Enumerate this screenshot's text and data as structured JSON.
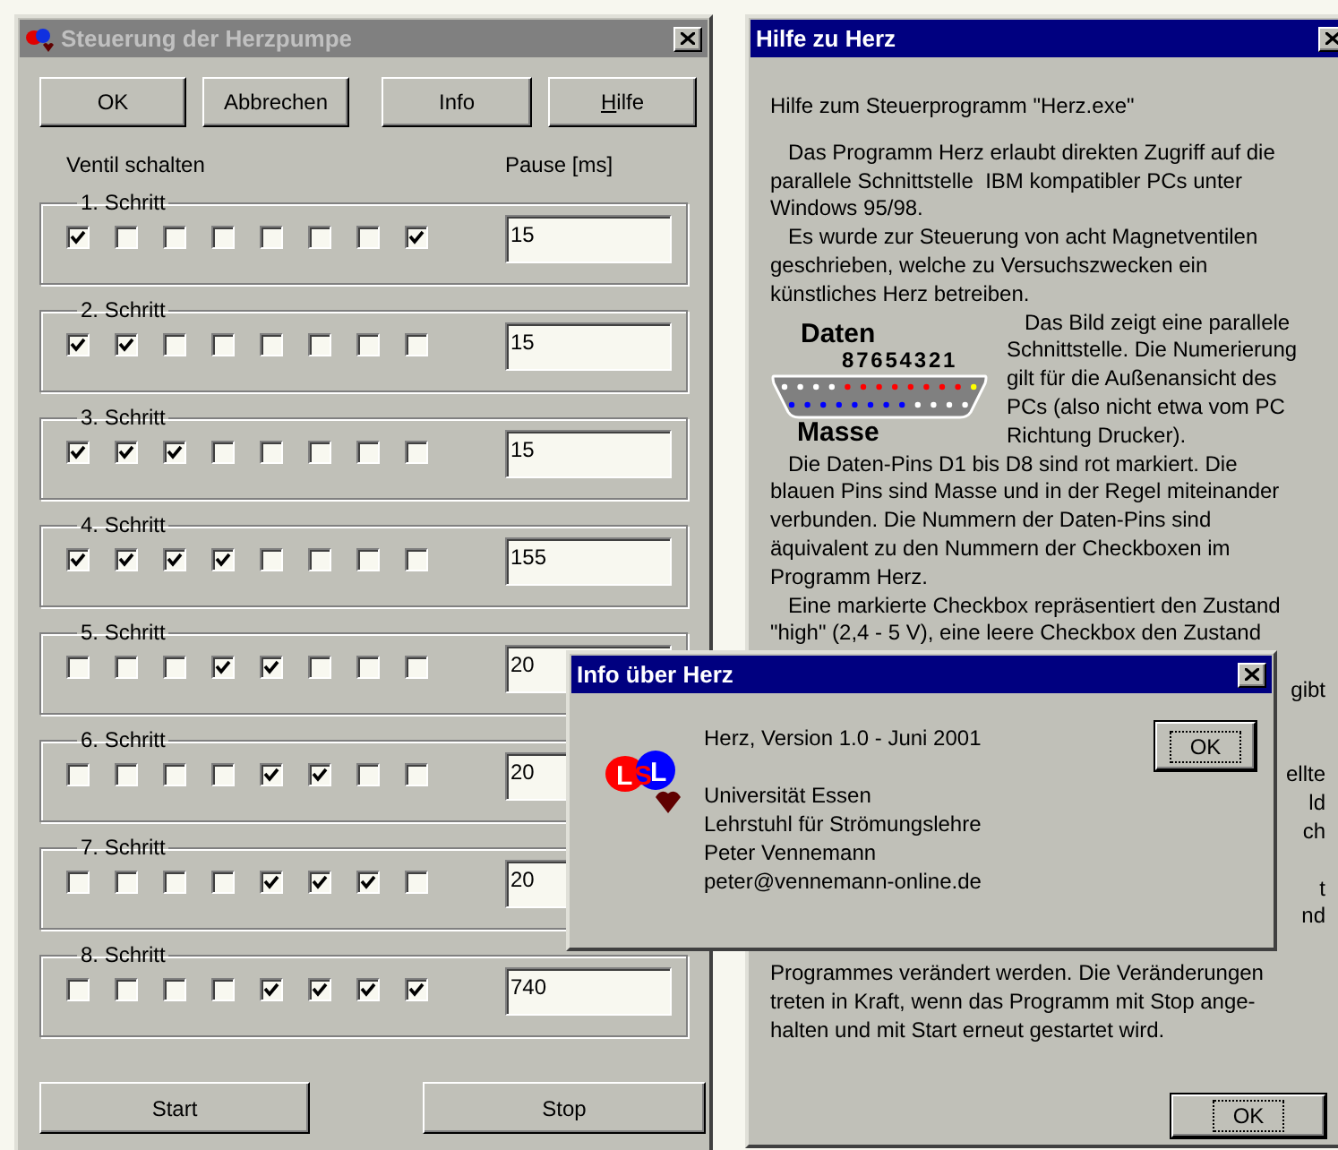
{
  "control_window": {
    "title": "Steuerung der Herzpumpe",
    "active": false,
    "buttons": [
      {
        "label": "OK"
      },
      {
        "label": "Abbrechen"
      },
      {
        "label": "Info"
      },
      {
        "mnemonic": "H",
        "label": "ilfe"
      }
    ],
    "valves_heading": "Ventil schalten",
    "pause_heading": "Pause [ms]",
    "steps": [
      {
        "label": "1. Schritt",
        "valves": [
          true,
          false,
          false,
          false,
          false,
          false,
          false,
          true
        ],
        "pause": "15"
      },
      {
        "label": "2. Schritt",
        "valves": [
          true,
          true,
          false,
          false,
          false,
          false,
          false,
          false
        ],
        "pause": "15"
      },
      {
        "label": "3. Schritt",
        "valves": [
          true,
          true,
          true,
          false,
          false,
          false,
          false,
          false
        ],
        "pause": "15"
      },
      {
        "label": "4. Schritt",
        "valves": [
          true,
          true,
          true,
          true,
          false,
          false,
          false,
          false
        ],
        "pause": "155"
      },
      {
        "label": "5. Schritt",
        "valves": [
          false,
          false,
          false,
          true,
          true,
          false,
          false,
          false
        ],
        "pause": "20"
      },
      {
        "label": "6. Schritt",
        "valves": [
          false,
          false,
          false,
          false,
          true,
          true,
          false,
          false
        ],
        "pause": "20"
      },
      {
        "label": "7. Schritt",
        "valves": [
          false,
          false,
          false,
          false,
          true,
          true,
          true,
          false
        ],
        "pause": "20"
      },
      {
        "label": "8. Schritt",
        "valves": [
          false,
          false,
          false,
          false,
          true,
          true,
          true,
          true
        ],
        "pause": "740"
      }
    ],
    "actions": [
      {
        "label": "Start"
      },
      {
        "label": "Stop"
      }
    ]
  },
  "help_window": {
    "title": "Hilfe zu Herz",
    "active": true,
    "heading": "Hilfe zum Steuerprogramm \"Herz.exe\"",
    "intro_lines": [
      {
        "text": "Das Programm Herz erlaubt direkten Zugriff auf die",
        "indent": true
      },
      {
        "text": "parallele Schnittstelle  IBM kompatibler PCs unter",
        "indent": false
      },
      {
        "text": "Windows 95/98.",
        "indent": false
      },
      {
        "text": "Es wurde zur Steuerung von acht Magnetventilen",
        "indent": true
      },
      {
        "text": "geschrieben, welche zu Versuchszwecken ein",
        "indent": false
      },
      {
        "text": "künstliches Herz betreiben.",
        "indent": false
      }
    ],
    "connector": {
      "top_label": "Daten",
      "pin_numbers": "87654321",
      "bottom_label": "Masse",
      "side_lines": [
        {
          "text": "Das Bild zeigt eine parallele",
          "indent": true
        },
        {
          "text": "Schnittstelle. Die Numerierung",
          "indent": false
        },
        {
          "text": "gilt für die Außenansicht des",
          "indent": false
        },
        {
          "text": "PCs (also nicht etwa vom PC",
          "indent": false
        },
        {
          "text": "Richtung Drucker).",
          "indent": false
        }
      ]
    },
    "lines": [
      {
        "kind": "line",
        "text": "Die Daten-Pins D1 bis D8 sind rot markiert. Die",
        "indent": true
      },
      {
        "kind": "line",
        "text": "blauen Pins sind Masse und in der Regel miteinander",
        "indent": false
      },
      {
        "kind": "line",
        "text": "verbunden. Die Nummern der Daten-Pins sind",
        "indent": false
      },
      {
        "kind": "line",
        "text": "äquivalent zu den Nummern der Checkboxen im",
        "indent": false
      },
      {
        "kind": "line",
        "text": "Programm Herz.",
        "indent": false
      },
      {
        "kind": "line",
        "text": "Eine markierte Checkbox repräsentiert den Zustand",
        "indent": true
      },
      {
        "kind": "line",
        "text": "\"high\" (2,4 - 5 V), eine leere Checkbox den Zustand",
        "indent": false
      },
      {
        "kind": "covered"
      },
      {
        "kind": "fragment",
        "text": "gibt"
      },
      {
        "kind": "covered"
      },
      {
        "kind": "covered"
      },
      {
        "kind": "fragment",
        "text": "ellte"
      },
      {
        "kind": "fragment",
        "text": "ld"
      },
      {
        "kind": "fragment",
        "text": "ch"
      },
      {
        "kind": "covered"
      },
      {
        "kind": "fragment",
        "text": "t"
      },
      {
        "kind": "fragment",
        "text": "nd"
      },
      {
        "kind": "covered"
      },
      {
        "kind": "line",
        "text": "Programmes verändert werden. Die Veränderungen",
        "indent": false
      },
      {
        "kind": "line",
        "text": "treten in Kraft, wenn das Programm mit Stop ange-",
        "indent": false
      },
      {
        "kind": "line",
        "text": "halten und mit Start erneut gestartet wird.",
        "indent": false
      }
    ],
    "ok_button": {
      "label": "OK",
      "focused": true
    }
  },
  "info_dialog": {
    "title": "Info über Herz",
    "active": true,
    "logo_letters": [
      "L",
      "S",
      "L"
    ],
    "version": "Herz, Version 1.0 - Juni 2001",
    "address_lines": [
      "Universität Essen",
      "Lehrstuhl für Strömungslehre",
      "Peter Vennemann",
      "peter@vennemann-online.de"
    ],
    "ok_button": {
      "label": "OK",
      "focused": true
    }
  }
}
